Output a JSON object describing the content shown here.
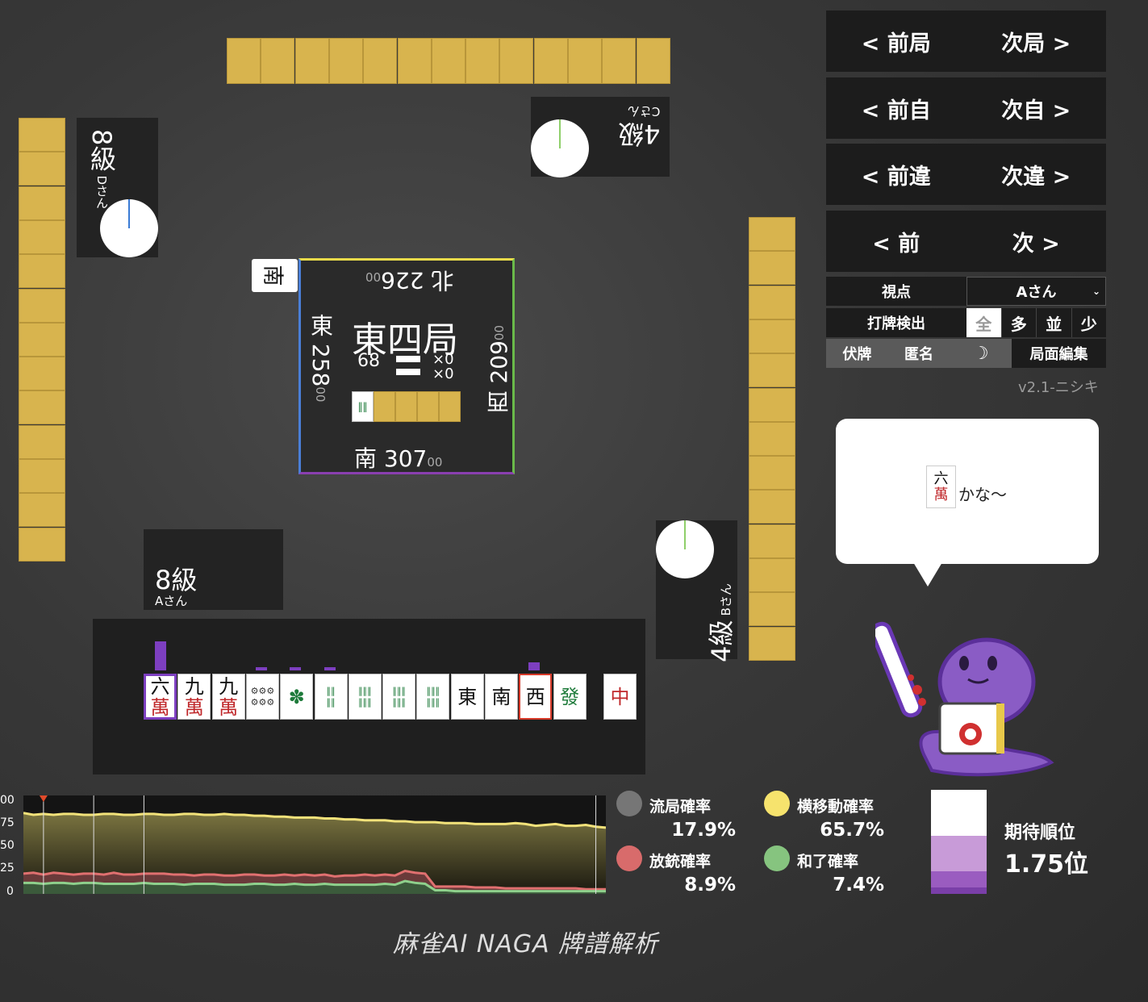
{
  "navigation": {
    "prev_round": "< 前局",
    "next_round": "次局 >",
    "prev_self": "< 前自",
    "next_self": "次自 >",
    "prev_diff": "< 前違",
    "next_diff": "次違 >",
    "prev": "< 前",
    "next": "次 >"
  },
  "controls": {
    "viewpoint_label": "視点",
    "viewpoint_value": "Aさん",
    "discard_detect_label": "打牌検出",
    "detect_options": [
      "全",
      "多",
      "並",
      "少"
    ],
    "hide_tiles": "伏牌",
    "anonymous": "匿名",
    "night_icon": "moon-icon",
    "edit_board": "局面編集",
    "version": "v2.1-ニシキ"
  },
  "players": {
    "top": {
      "rank": "4級",
      "name": "Cさん"
    },
    "left": {
      "rank": "8級",
      "name": "Dさん"
    },
    "right": {
      "rank": "4級",
      "name": "Bさん"
    },
    "self": {
      "rank": "8級",
      "name": "Aさん"
    }
  },
  "center": {
    "round": "東四局",
    "tiles_left": "68",
    "honba": "×0",
    "riichi": "×0",
    "round_wind_tile": "南",
    "north": {
      "wind": "北",
      "score": "226",
      "sub": "00"
    },
    "east": {
      "wind": "東",
      "score": "258",
      "sub": "00"
    },
    "west": {
      "wind": "西",
      "score": "209",
      "sub": "00"
    },
    "south": {
      "wind": "南",
      "score": "307",
      "sub": "00"
    }
  },
  "hand": [
    {
      "top": "六",
      "bottom": "萬",
      "color": "#c0282b",
      "name": "tile-6m",
      "bar": 0,
      "selected": true
    },
    {
      "top": "九",
      "bottom": "萬",
      "color": "#c0282b",
      "name": "tile-9m",
      "bar": 0
    },
    {
      "top": "九",
      "bottom": "萬",
      "color": "#c0282b",
      "name": "tile-9m",
      "bar": 0
    },
    {
      "top": "⚙⚙⚙",
      "bottom": "⚙⚙⚙",
      "color": "#333",
      "name": "tile-9p",
      "bar": 0
    },
    {
      "top": "✽",
      "bottom": "",
      "color": "#1d7a3a",
      "name": "tile-1s",
      "bar": 0
    },
    {
      "top": "‖‖",
      "bottom": "‖‖",
      "color": "#1d7a3a",
      "name": "tile-4s",
      "bar": 0
    },
    {
      "top": "‖‖‖",
      "bottom": "‖‖‖",
      "color": "#1d7a3a",
      "name": "tile-6s",
      "bar": 0
    },
    {
      "top": "‖‖‖",
      "bottom": "‖‖‖",
      "color": "#1d7a3a",
      "name": "tile-7s",
      "bar": 0
    },
    {
      "top": "‖‖‖",
      "bottom": "‖‖‖",
      "color": "#1d7a3a",
      "name": "tile-8s",
      "bar": 0
    },
    {
      "top": "東",
      "bottom": "",
      "color": "#111",
      "name": "tile-east",
      "bar": 0
    },
    {
      "top": "南",
      "bottom": "",
      "color": "#111",
      "name": "tile-south",
      "bar": 0
    },
    {
      "top": "西",
      "bottom": "",
      "color": "#111",
      "name": "tile-west",
      "bar": 0,
      "highlight": true
    },
    {
      "top": "發",
      "bottom": "",
      "color": "#1d7a3a",
      "name": "tile-green",
      "bar": 0
    },
    {
      "top": "中",
      "bottom": "",
      "color": "#c0282b",
      "name": "tile-red",
      "bar": 0
    }
  ],
  "speech": {
    "tile_top": "六",
    "tile_bottom": "萬",
    "text": "かな～"
  },
  "chart_data": {
    "type": "area",
    "y_ticks": [
      "00",
      "75",
      "50",
      "25",
      "0"
    ],
    "ylim": [
      0,
      100
    ],
    "series": [
      {
        "color": "#f2e27a",
        "values": [
          88,
          86,
          87,
          86,
          87,
          87,
          86,
          86,
          87,
          87,
          86,
          86,
          87,
          87,
          86,
          86,
          87,
          87,
          86,
          86,
          87,
          86,
          86,
          85,
          85,
          84,
          84,
          83,
          83,
          83,
          82,
          82,
          81,
          81,
          80,
          80,
          80,
          79,
          79,
          78,
          78,
          78,
          77,
          77,
          77,
          76,
          76,
          76,
          76,
          77,
          76,
          74,
          75,
          76,
          74,
          74,
          75,
          73,
          72
        ]
      },
      {
        "color": "#e07070",
        "values": [
          22,
          23,
          21,
          23,
          22,
          21,
          22,
          22,
          21,
          23,
          21,
          21,
          22,
          22,
          22,
          21,
          21,
          20,
          21,
          21,
          20,
          20,
          21,
          21,
          20,
          20,
          21,
          20,
          21,
          20,
          21,
          19,
          20,
          20,
          21,
          20,
          21,
          20,
          25,
          23,
          22,
          8,
          8,
          8,
          8,
          7,
          7,
          7,
          6,
          6,
          6,
          6,
          6,
          6,
          6,
          6,
          5,
          5,
          5
        ]
      },
      {
        "color": "#8ed08c",
        "values": [
          12,
          12,
          11,
          12,
          12,
          11,
          12,
          12,
          11,
          11,
          11,
          11,
          12,
          11,
          11,
          11,
          10,
          11,
          11,
          11,
          10,
          10,
          10,
          11,
          11,
          10,
          10,
          11,
          10,
          10,
          11,
          10,
          10,
          10,
          10,
          10,
          11,
          10,
          14,
          12,
          11,
          4,
          4,
          3,
          3,
          3,
          3,
          3,
          3,
          3,
          3,
          3,
          3,
          3,
          3,
          3,
          3,
          3,
          3
        ]
      }
    ],
    "vertical_markers": [
      2,
      7,
      12,
      57
    ]
  },
  "stats": {
    "ryukyoku_label": "流局確率",
    "ryukyoku_value": "17.9%",
    "ryukyoku_color": "#767676",
    "yoko_label": "横移動確率",
    "yoko_value": "65.7%",
    "yoko_color": "#f6e36d",
    "houju_label": "放銃確率",
    "houju_value": "8.9%",
    "houju_color": "#d86b6b",
    "agari_label": "和了確率",
    "agari_value": "7.4%",
    "agari_color": "#86c47f"
  },
  "expected_rank": {
    "label": "期待順位",
    "value": "1.75位",
    "fractions": [
      0.56,
      0.39,
      0.15,
      0.05
    ]
  },
  "logo": "麻雀AI NAGA 牌譜解析"
}
